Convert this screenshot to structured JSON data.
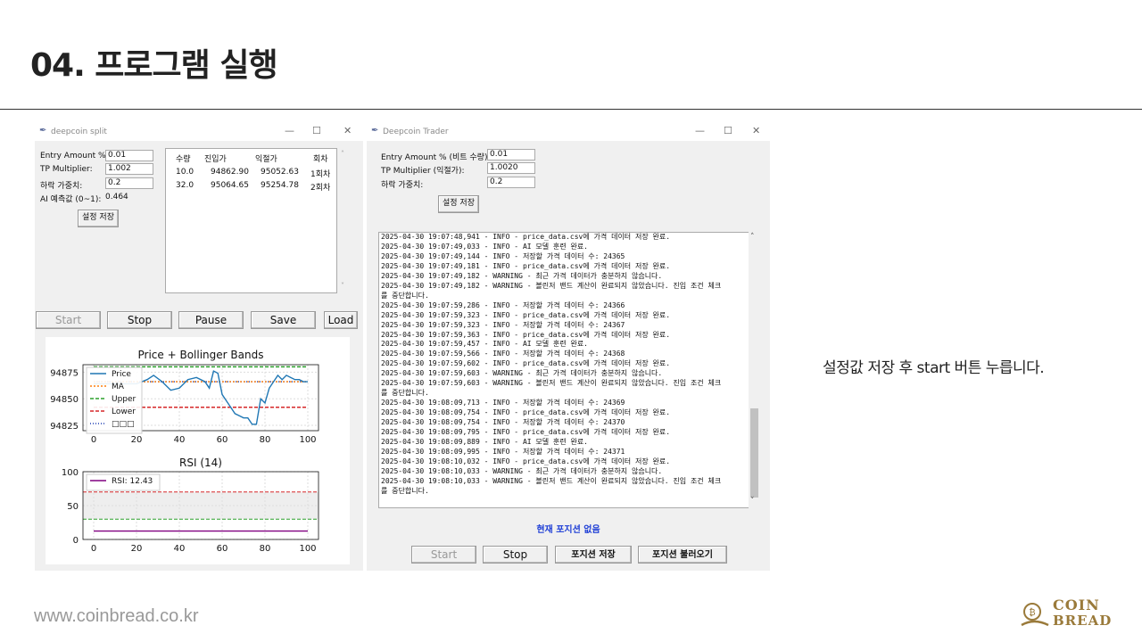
{
  "slide": {
    "title": "04.  프로그램 실행",
    "caption": "설정값 저장 후 start 버튼 누릅니다.",
    "footer_url": "www.coinbread.co.kr",
    "logo_line1": "COIN",
    "logo_line2": "BREAD"
  },
  "win1": {
    "title": "deepcoin split",
    "controls": {
      "minimize": "—",
      "maximize": "☐",
      "close": "✕"
    },
    "entry_amount_label": "Entry Amount %:",
    "entry_amount_value": "0.01",
    "tp_label": "TP Multiplier:",
    "tp_value": "1.002",
    "weight_label": "하락 가중치:",
    "weight_value": "0.2",
    "ai_label": "AI 예측값 (0~1):",
    "ai_value": "0.464",
    "save_settings": "설정 저장",
    "table": {
      "headers": [
        "수량",
        "진입가",
        "익절가",
        "회차"
      ],
      "rows": [
        [
          "10.0",
          "94862.90",
          "95052.63",
          "1회차"
        ],
        [
          "32.0",
          "95064.65",
          "95254.78",
          "2회차"
        ]
      ]
    },
    "buttons": {
      "start": "Start",
      "stop": "Stop",
      "pause": "Pause",
      "save": "Save",
      "load": "Load"
    }
  },
  "chart_data": [
    {
      "type": "line",
      "title": "Price + Bollinger Bands",
      "xlabel": "",
      "ylabel": "",
      "xlim": [
        -5,
        105
      ],
      "ylim": [
        94820,
        94882
      ],
      "xticks": [
        "0",
        "20",
        "40",
        "60",
        "80",
        "100"
      ],
      "yticks": [
        "94825",
        "94850",
        "94875"
      ],
      "legend": [
        "Price",
        "MA",
        "Upper",
        "Lower",
        "□□□"
      ],
      "legend_placement": "upper-left",
      "grid": true,
      "series": [
        {
          "name": "Price",
          "color": "#1f77b4",
          "x": [
            0,
            10,
            20,
            25,
            28,
            32,
            36,
            40,
            44,
            48,
            52,
            54,
            55,
            56,
            58,
            60,
            62,
            64,
            66,
            68,
            70,
            72,
            74,
            76,
            78,
            80,
            82,
            84,
            86,
            88,
            90,
            92,
            94,
            96,
            98,
            100
          ],
          "values": [
            94864,
            94864,
            94864,
            94868,
            94872,
            94866,
            94858,
            94860,
            94868,
            94870,
            94866,
            94860,
            94868,
            94876,
            94874,
            94854,
            94848,
            94842,
            94836,
            94834,
            94832,
            94832,
            94826,
            94826,
            94850,
            94846,
            94860,
            94866,
            94872,
            94868,
            94872,
            94870,
            94868,
            94868,
            94866,
            94866
          ]
        },
        {
          "name": "MA",
          "color": "#ff7f0e",
          "x": [
            0,
            100
          ],
          "values": [
            94866,
            94866
          ]
        },
        {
          "name": "Upper",
          "color": "#2ca02c",
          "x": [
            0,
            100
          ],
          "values": [
            94880,
            94880
          ]
        },
        {
          "name": "Lower",
          "color": "#d62728",
          "x": [
            0,
            100
          ],
          "values": [
            94842,
            94842
          ]
        },
        {
          "name": "□□□",
          "color": "#1f3fb4",
          "x": [
            0,
            100
          ],
          "values": [
            94866,
            94866
          ]
        }
      ]
    },
    {
      "type": "line",
      "title": "RSI (14)",
      "xlabel": "",
      "ylabel": "",
      "xlim": [
        -5,
        105
      ],
      "ylim": [
        0,
        100
      ],
      "xticks": [
        "0",
        "20",
        "40",
        "60",
        "80",
        "100"
      ],
      "yticks": [
        "0",
        "50",
        "100"
      ],
      "legend": [
        "RSI: 12.43"
      ],
      "legend_placement": "upper-left",
      "grid": true,
      "overbought": 70,
      "oversold": 30,
      "series": [
        {
          "name": "RSI: 12.43",
          "color": "#800080",
          "x": [
            0,
            100
          ],
          "values": [
            12.43,
            12.43
          ]
        }
      ]
    }
  ],
  "win2": {
    "title": "Deepcoin Trader",
    "controls": {
      "minimize": "—",
      "maximize": "☐",
      "close": "✕"
    },
    "entry_amount_label": "Entry Amount % (비트 수량):",
    "entry_amount_value": "0.01",
    "tp_label": "TP Multiplier (익절가):",
    "tp_value": "1.0020",
    "weight_label": "하락 가중치:",
    "weight_value": "0.2",
    "save_settings": "설정 저장",
    "log_lines": [
      "2025-04-30 19:07:48,941 - INFO - price_data.csv에 가격 데이터 저장 완료.",
      "2025-04-30 19:07:49,033 - INFO - AI 모델 훈련 완료.",
      "2025-04-30 19:07:49,144 - INFO - 저장할 가격 데이터 수: 24365",
      "2025-04-30 19:07:49,181 - INFO - price_data.csv에 가격 데이터 저장 완료.",
      "2025-04-30 19:07:49,182 - WARNING - 최근 가격 데이터가 충분하지 않습니다.",
      "2025-04-30 19:07:49,182 - WARNING - 볼린저 밴드 계산이 완료되지 않았습니다. 진입 조건 체크",
      "를 중단합니다.",
      "2025-04-30 19:07:59,286 - INFO - 저장할 가격 데이터 수: 24366",
      "2025-04-30 19:07:59,323 - INFO - price_data.csv에 가격 데이터 저장 완료.",
      "2025-04-30 19:07:59,323 - INFO - 저장할 가격 데이터 수: 24367",
      "2025-04-30 19:07:59,363 - INFO - price_data.csv에 가격 데이터 저장 완료.",
      "2025-04-30 19:07:59,457 - INFO - AI 모델 훈련 완료.",
      "2025-04-30 19:07:59,566 - INFO - 저장할 가격 데이터 수: 24368",
      "2025-04-30 19:07:59,602 - INFO - price_data.csv에 가격 데이터 저장 완료.",
      "2025-04-30 19:07:59,603 - WARNING - 최근 가격 데이터가 충분하지 않습니다.",
      "2025-04-30 19:07:59,603 - WARNING - 볼린저 밴드 계산이 완료되지 않았습니다. 진입 조건 체크",
      "를 중단합니다.",
      "2025-04-30 19:08:09,713 - INFO - 저장할 가격 데이터 수: 24369",
      "2025-04-30 19:08:09,754 - INFO - price_data.csv에 가격 데이터 저장 완료.",
      "2025-04-30 19:08:09,754 - INFO - 저장할 가격 데이터 수: 24370",
      "2025-04-30 19:08:09,795 - INFO - price_data.csv에 가격 데이터 저장 완료.",
      "2025-04-30 19:08:09,889 - INFO - AI 모델 훈련 완료.",
      "2025-04-30 19:08:09,995 - INFO - 저장할 가격 데이터 수: 24371",
      "2025-04-30 19:08:10,032 - INFO - price_data.csv에 가격 데이터 저장 완료.",
      "2025-04-30 19:08:10,033 - WARNING - 최근 가격 데이터가 충분하지 않습니다.",
      "2025-04-30 19:08:10,033 - WARNING - 볼린저 밴드 계산이 완료되지 않았습니다. 진입 조건 체크",
      "를 중단합니다."
    ],
    "status": "현재 포지션 없음",
    "buttons": {
      "start": "Start",
      "stop": "Stop",
      "save_position": "포지션 저장",
      "load_position": "포지션 불러오기"
    }
  }
}
